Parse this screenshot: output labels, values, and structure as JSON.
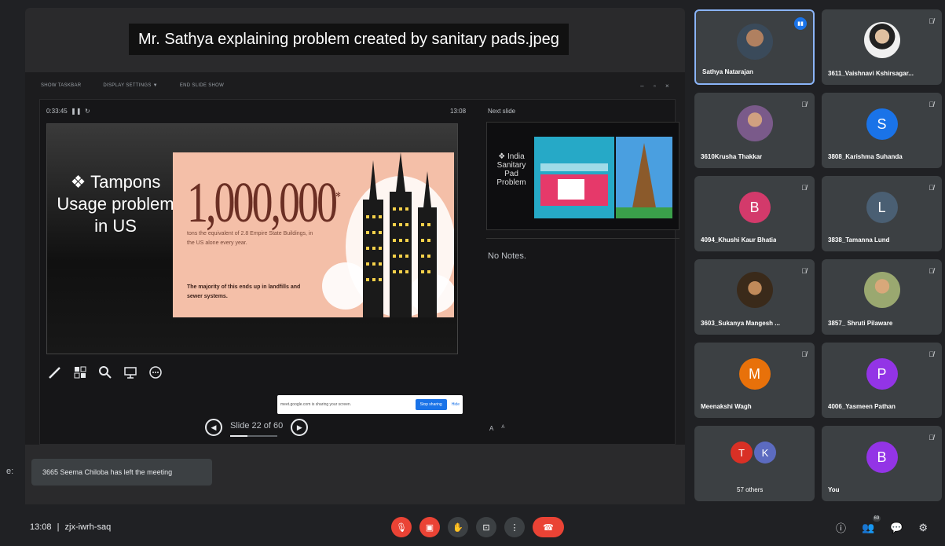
{
  "caption": "Mr. Sathya explaining problem created by sanitary pads.jpeg",
  "presenter_view": {
    "toolbar": [
      "SHOW TASKBAR",
      "DISPLAY SETTINGS ▼",
      "END SLIDE SHOW"
    ],
    "timer": "0:33:45",
    "clock": "13:08",
    "slide": {
      "heading": "❖ Tampons Usage problem in US",
      "big_number": "1,000,000",
      "big_number_sup": "*",
      "subtext": "tons the equivalent of 2.8 Empire State Buildings, in the US alone every year.",
      "footer": "The majority of this ends up in landfills and sewer systems."
    },
    "next_label": "Next slide",
    "next_slide_text": "❖ India Sanitary Pad Problem",
    "notes": "No Notes.",
    "slide_counter": "Slide 22 of 60",
    "font_controls": [
      "A",
      "A"
    ],
    "progress": 0.37
  },
  "share_bar": {
    "text": "meet.google.com is sharing your screen.",
    "stop": "Stop sharing",
    "hide": "Hide"
  },
  "toast": "3665 Seema Chiloba has left the meeting",
  "stub_letter": "e:",
  "participants": [
    {
      "name": "Sathya Natarajan",
      "avatar": "photo",
      "color": "#5f6368",
      "muted": false,
      "speaking": true
    },
    {
      "name": "3611_Vaishnavi Kshirsagar...",
      "avatar": "photo",
      "color": "#6d6d6d",
      "muted": true
    },
    {
      "name": "3610Krusha Thakkar",
      "avatar": "photo",
      "color": "#8a6d8a",
      "muted": true
    },
    {
      "name": "3808_Karishma Suhanda",
      "avatar": "S",
      "color": "#1a73e8",
      "muted": true
    },
    {
      "name": "4094_Khushi Kaur Bhatia",
      "avatar": "B",
      "color": "#d33a6b",
      "muted": true
    },
    {
      "name": "3838_Tamanna Lund",
      "avatar": "L",
      "color": "#4a5f73",
      "muted": true
    },
    {
      "name": "3603_Sukanya Mangesh ...",
      "avatar": "photo",
      "color": "#7a5a3a",
      "muted": true
    },
    {
      "name": "3857_ Shruti Pilaware",
      "avatar": "photo",
      "color": "#9aa870",
      "muted": true
    },
    {
      "name": "Meenakshi Wagh",
      "avatar": "M",
      "color": "#e8710a",
      "muted": true
    },
    {
      "name": "4006_Yasmeen Pathan",
      "avatar": "P",
      "color": "#9334e6",
      "muted": true
    },
    {
      "name": "57 others",
      "avatar": "group",
      "group": [
        "T",
        "K"
      ],
      "group_colors": [
        "#d93025",
        "#5c6bc0"
      ],
      "muted": false
    },
    {
      "name": "You",
      "avatar": "B",
      "color": "#9334e6",
      "muted": true
    }
  ],
  "bottom": {
    "time": "13:08",
    "separator": "|",
    "meeting_code": "zjx-iwrh-saq",
    "people_count": "69"
  }
}
